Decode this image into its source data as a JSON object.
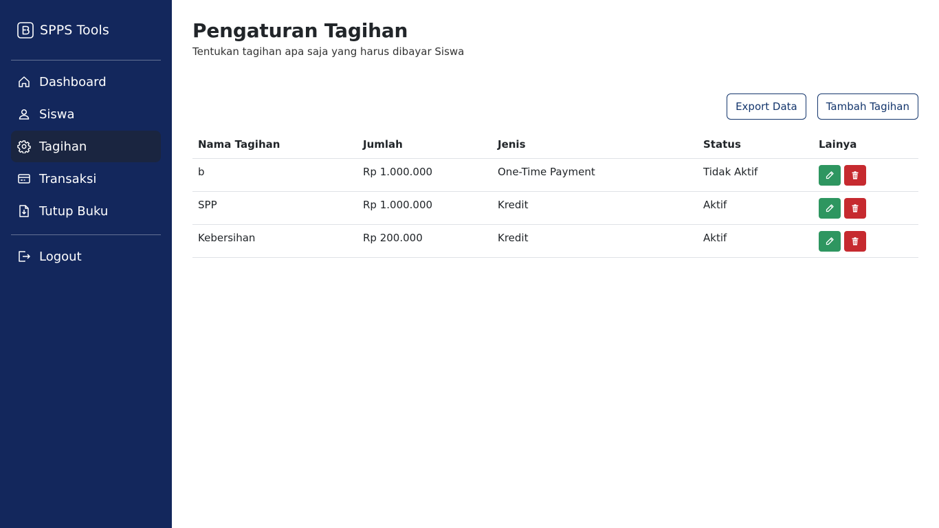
{
  "app": {
    "brand": "SPPS Tools",
    "brand_icon": "bootstrap-logo-icon"
  },
  "sidebar": {
    "items": [
      {
        "label": "Dashboard",
        "icon": "house-icon",
        "active": false
      },
      {
        "label": "Siswa",
        "icon": "person-icon",
        "active": false
      },
      {
        "label": "Tagihan",
        "icon": "gear-icon",
        "active": true
      },
      {
        "label": "Transaksi",
        "icon": "credit-card-icon",
        "active": false
      },
      {
        "label": "Tutup Buku",
        "icon": "file-arrow-down-icon",
        "active": false
      }
    ],
    "logout": {
      "label": "Logout",
      "icon": "box-arrow-right-icon"
    }
  },
  "page": {
    "title": "Pengaturan Tagihan",
    "subtitle": "Tentukan tagihan apa saja yang harus dibayar Siswa"
  },
  "actions": {
    "export_label": "Export Data",
    "add_label": "Tambah Tagihan"
  },
  "table": {
    "headers": [
      "Nama Tagihan",
      "Jumlah",
      "Jenis",
      "Status",
      "Lainya"
    ],
    "rows": [
      {
        "name": "b",
        "amount": "Rp 1.000.000",
        "type": "One-Time Payment",
        "status": "Tidak Aktif"
      },
      {
        "name": "SPP",
        "amount": "Rp 1.000.000",
        "type": "Kredit",
        "status": "Aktif"
      },
      {
        "name": "Kebersihan",
        "amount": "Rp 200.000",
        "type": "Kredit",
        "status": "Aktif"
      }
    ]
  },
  "colors": {
    "sidebar_bg": "#13275c",
    "active_item_bg": "#1a2540",
    "outline_button": "#13356c",
    "edit_button": "#2e9660",
    "delete_button": "#c62a2f"
  }
}
